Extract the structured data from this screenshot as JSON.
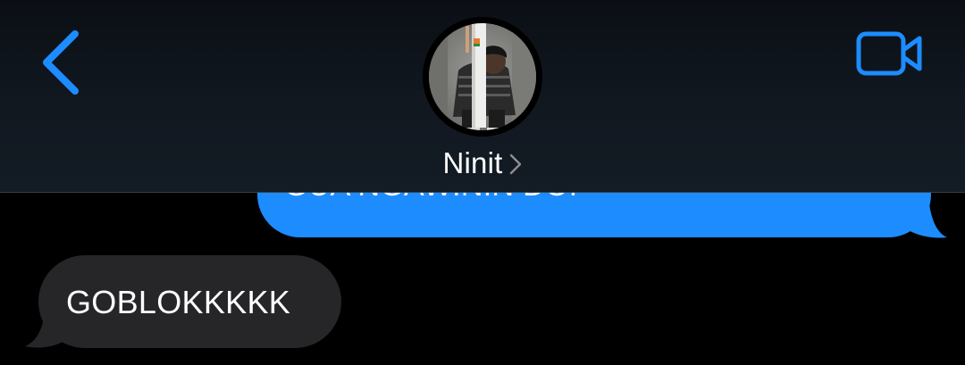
{
  "header": {
    "contact_name": "Ninit",
    "back_icon": "chevron-left-icon",
    "video_icon": "video-camera-icon",
    "details_icon": "chevron-right-icon",
    "accent_color": "#1d8cff"
  },
  "messages": [
    {
      "direction": "outgoing",
      "text": "GUA NGAWININ DOI",
      "bubble_color": "#1d8cff"
    },
    {
      "direction": "incoming",
      "text": "GOBLOKKKKK",
      "bubble_color": "#262628"
    }
  ]
}
